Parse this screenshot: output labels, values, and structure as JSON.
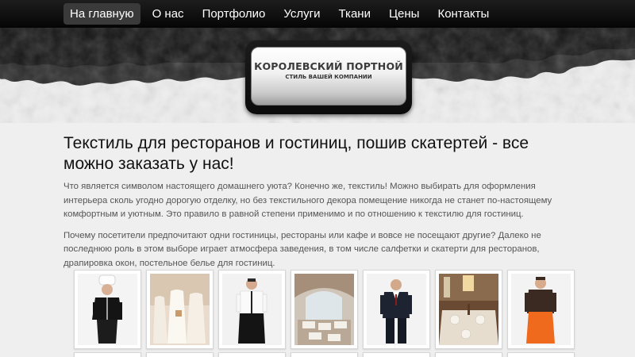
{
  "nav": {
    "items": [
      {
        "label": "На главную",
        "active": true
      },
      {
        "label": "О нас",
        "active": false
      },
      {
        "label": "Портфолио",
        "active": false
      },
      {
        "label": "Услуги",
        "active": false
      },
      {
        "label": "Ткани",
        "active": false
      },
      {
        "label": "Цены",
        "active": false
      },
      {
        "label": "Контакты",
        "active": false
      }
    ]
  },
  "logo": {
    "title": "КОРОЛЕВСКИЙ ПОРТНОЙ",
    "subtitle": "СТИЛЬ ВАШЕЙ КОМПАНИИ"
  },
  "main": {
    "title": "Текстиль для ресторанов и гостиниц, пошив скатертей - все можно заказать у нас!",
    "paragraphs": [
      "Что является символом настоящего домашнего уюта? Конечно же, текстиль! Можно выбирать для оформления интерьера сколь угодно дорогую отделку, но без текстильного декора помещение никогда не станет по-настоящему комфортным и уютным. Это правило в равной степени применимо и по отношению к текстилю для гостиниц.",
      "Почему посетители предпочитают одни гостиницы, рестораны или кафе и вовсе не посещают другие? Далеко не последнюю роль в этом выборе играет атмосфера заведения, в том числе салфетки и скатерти для ресторанов, драпировка окон, постельное белье для гостиниц."
    ]
  },
  "gallery": {
    "photos": [
      {
        "subject": "chef-uniform-photo"
      },
      {
        "subject": "banquet-chair-covers-photo"
      },
      {
        "subject": "waiter-apron-photo"
      },
      {
        "subject": "restaurant-hall-photo"
      },
      {
        "subject": "suit-uniform-photo"
      },
      {
        "subject": "restaurant-table-linen-photo"
      },
      {
        "subject": "waiter-orange-apron-photo"
      }
    ]
  },
  "colors": {
    "navbar": "#0d0d0d",
    "nav_active": "#3a3a3a",
    "page_background": "#efefef",
    "text_dark": "#111111",
    "text_body": "#555555"
  }
}
